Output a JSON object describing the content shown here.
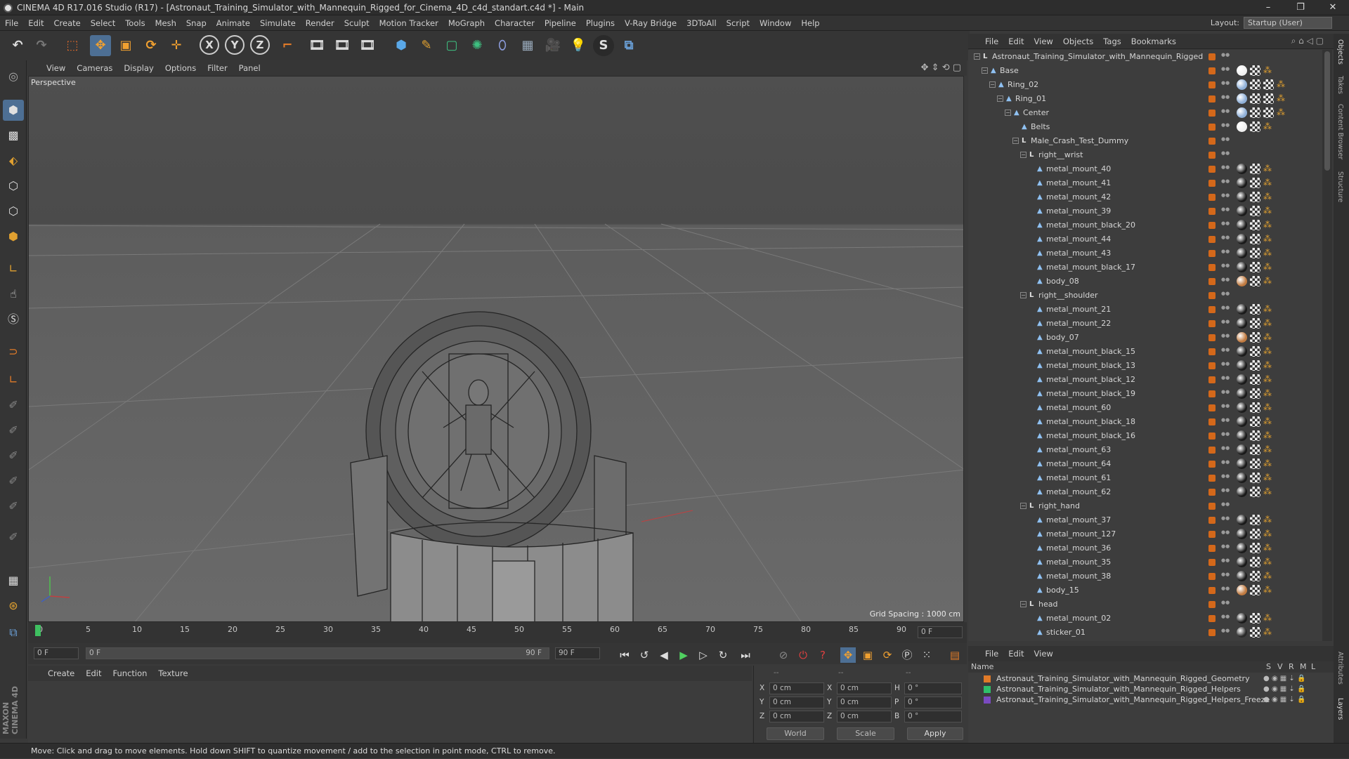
{
  "window": {
    "title": "CINEMA 4D R17.016 Studio (R17) - [Astronaut_Training_Simulator_with_Mannequin_Rigged_for_Cinema_4D_c4d_standart.c4d *] - Main",
    "minimize": "–",
    "maximize": "❐",
    "close": "✕"
  },
  "menu": [
    "File",
    "Edit",
    "Create",
    "Select",
    "Tools",
    "Mesh",
    "Snap",
    "Animate",
    "Simulate",
    "Render",
    "Sculpt",
    "Motion Tracker",
    "MoGraph",
    "Character",
    "Pipeline",
    "Plugins",
    "V-Ray Bridge",
    "3DToAll",
    "Script",
    "Window",
    "Help"
  ],
  "layout": {
    "label": "Layout:",
    "value": "Startup (User)"
  },
  "viewport": {
    "menu": [
      "View",
      "Cameras",
      "Display",
      "Options",
      "Filter",
      "Panel"
    ],
    "label": "Perspective",
    "grid_spacing": "Grid Spacing : 1000 cm"
  },
  "timeline": {
    "ticks": [
      "0",
      "5",
      "10",
      "15",
      "20",
      "25",
      "30",
      "35",
      "40",
      "45",
      "50",
      "55",
      "60",
      "65",
      "70",
      "75",
      "80",
      "85",
      "90"
    ],
    "current_frame": "0 F"
  },
  "transport": {
    "start": "0 F",
    "range_start": "0 F",
    "range_end": "90 F",
    "end": "90 F"
  },
  "material": {
    "menu": [
      "Create",
      "Edit",
      "Function",
      "Texture"
    ]
  },
  "coords": {
    "rows": [
      [
        "X",
        "0 cm",
        "X",
        "0 cm",
        "H",
        "0 °"
      ],
      [
        "Y",
        "0 cm",
        "Y",
        "0 cm",
        "P",
        "0 °"
      ],
      [
        "Z",
        "0 cm",
        "Z",
        "0 cm",
        "B",
        "0 °"
      ]
    ],
    "world": "World",
    "scale": "Scale",
    "apply": "Apply",
    "dashes": "--"
  },
  "objects_menu": [
    "File",
    "Edit",
    "View",
    "Objects",
    "Tags",
    "Bookmarks"
  ],
  "objects": [
    {
      "name": "Astronaut_Training_Simulator_with_Mannequin_Rigged",
      "d": 0,
      "k": "null",
      "e": "−",
      "t": 0
    },
    {
      "name": "Base",
      "d": 1,
      "k": "bone",
      "e": "−",
      "t": 1
    },
    {
      "name": "Ring_02",
      "d": 2,
      "k": "bone",
      "e": "−",
      "t": 2
    },
    {
      "name": "Ring_01",
      "d": 3,
      "k": "bone",
      "e": "−",
      "t": 2
    },
    {
      "name": "Center",
      "d": 4,
      "k": "bone",
      "e": "−",
      "t": 2
    },
    {
      "name": "Belts",
      "d": 5,
      "k": "bone",
      "e": "",
      "t": 3
    },
    {
      "name": "Male_Crash_Test_Dummy",
      "d": 5,
      "k": "null",
      "e": "−",
      "t": 0
    },
    {
      "name": "right__wrist",
      "d": 6,
      "k": "null",
      "e": "−",
      "t": 0
    },
    {
      "name": "metal_mount_40",
      "d": 7,
      "k": "bone",
      "e": "",
      "t": 4
    },
    {
      "name": "metal_mount_41",
      "d": 7,
      "k": "bone",
      "e": "",
      "t": 4
    },
    {
      "name": "metal_mount_42",
      "d": 7,
      "k": "bone",
      "e": "",
      "t": 4
    },
    {
      "name": "metal_mount_39",
      "d": 7,
      "k": "bone",
      "e": "",
      "t": 4
    },
    {
      "name": "metal_mount_black_20",
      "d": 7,
      "k": "bone",
      "e": "",
      "t": 4
    },
    {
      "name": "metal_mount_44",
      "d": 7,
      "k": "bone",
      "e": "",
      "t": 4
    },
    {
      "name": "metal_mount_43",
      "d": 7,
      "k": "bone",
      "e": "",
      "t": 4
    },
    {
      "name": "metal_mount_black_17",
      "d": 7,
      "k": "bone",
      "e": "",
      "t": 4
    },
    {
      "name": "body_08",
      "d": 7,
      "k": "bone",
      "e": "",
      "t": 5
    },
    {
      "name": "right__shoulder",
      "d": 6,
      "k": "null",
      "e": "−",
      "t": 0
    },
    {
      "name": "metal_mount_21",
      "d": 7,
      "k": "bone",
      "e": "",
      "t": 4
    },
    {
      "name": "metal_mount_22",
      "d": 7,
      "k": "bone",
      "e": "",
      "t": 4
    },
    {
      "name": "body_07",
      "d": 7,
      "k": "bone",
      "e": "",
      "t": 5
    },
    {
      "name": "metal_mount_black_15",
      "d": 7,
      "k": "bone",
      "e": "",
      "t": 4
    },
    {
      "name": "metal_mount_black_13",
      "d": 7,
      "k": "bone",
      "e": "",
      "t": 4
    },
    {
      "name": "metal_mount_black_12",
      "d": 7,
      "k": "bone",
      "e": "",
      "t": 4
    },
    {
      "name": "metal_mount_black_19",
      "d": 7,
      "k": "bone",
      "e": "",
      "t": 4
    },
    {
      "name": "metal_mount_60",
      "d": 7,
      "k": "bone",
      "e": "",
      "t": 4
    },
    {
      "name": "metal_mount_black_18",
      "d": 7,
      "k": "bone",
      "e": "",
      "t": 4
    },
    {
      "name": "metal_mount_black_16",
      "d": 7,
      "k": "bone",
      "e": "",
      "t": 4
    },
    {
      "name": "metal_mount_63",
      "d": 7,
      "k": "bone",
      "e": "",
      "t": 4
    },
    {
      "name": "metal_mount_64",
      "d": 7,
      "k": "bone",
      "e": "",
      "t": 4
    },
    {
      "name": "metal_mount_61",
      "d": 7,
      "k": "bone",
      "e": "",
      "t": 4
    },
    {
      "name": "metal_mount_62",
      "d": 7,
      "k": "bone",
      "e": "",
      "t": 4
    },
    {
      "name": "right_hand",
      "d": 6,
      "k": "null",
      "e": "−",
      "t": 0
    },
    {
      "name": "metal_mount_37",
      "d": 7,
      "k": "bone",
      "e": "",
      "t": 4
    },
    {
      "name": "metal_mount_127",
      "d": 7,
      "k": "bone",
      "e": "",
      "t": 4
    },
    {
      "name": "metal_mount_36",
      "d": 7,
      "k": "bone",
      "e": "",
      "t": 4
    },
    {
      "name": "metal_mount_35",
      "d": 7,
      "k": "bone",
      "e": "",
      "t": 4
    },
    {
      "name": "metal_mount_38",
      "d": 7,
      "k": "bone",
      "e": "",
      "t": 4
    },
    {
      "name": "body_15",
      "d": 7,
      "k": "bone",
      "e": "",
      "t": 5
    },
    {
      "name": "head",
      "d": 6,
      "k": "null",
      "e": "−",
      "t": 0
    },
    {
      "name": "metal_mount_02",
      "d": 7,
      "k": "bone",
      "e": "",
      "t": 4
    },
    {
      "name": "sticker_01",
      "d": 7,
      "k": "bone",
      "e": "",
      "t": 6
    }
  ],
  "layers_menu": [
    "File",
    "Edit",
    "View"
  ],
  "layers_header": {
    "name": "Name",
    "cols": [
      "S",
      "V",
      "R",
      "M",
      "L"
    ]
  },
  "layers": [
    {
      "name": "Astronaut_Training_Simulator_with_Mannequin_Rigged_Geometry",
      "color": "#e07a28"
    },
    {
      "name": "Astronaut_Training_Simulator_with_Mannequin_Rigged_Helpers",
      "color": "#2fbf6a"
    },
    {
      "name": "Astronaut_Training_Simulator_with_Mannequin_Rigged_Helpers_Freeze",
      "color": "#7a4ac0"
    }
  ],
  "right_tabs": [
    "Objects",
    "Takes",
    "Content Browser",
    "Structure"
  ],
  "right_tabs_bottom": [
    "Attributes",
    "Layers"
  ],
  "status": "Move: Click and drag to move elements. Hold down SHIFT to quantize movement / add to the selection in point mode, CTRL to remove.",
  "brand": {
    "line1": "MAXON",
    "line2": "CINEMA 4D"
  }
}
